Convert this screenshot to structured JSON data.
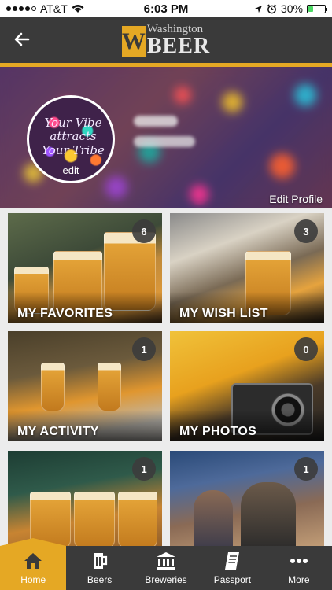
{
  "status": {
    "carrier": "AT&T",
    "time": "6:03 PM",
    "battery": "30%",
    "battery_level": 0.3
  },
  "header": {
    "logo_w": "W",
    "logo_top": "Washington",
    "logo_bottom": "BEER",
    "back_icon": "arrow-left-icon"
  },
  "profile": {
    "avatar_text": "Your Vibe attracts Your Tribe",
    "avatar_edit": "edit",
    "edit_profile": "Edit Profile"
  },
  "tiles": [
    {
      "label": "MY FAVORITES",
      "count": "6"
    },
    {
      "label": "MY WISH LIST",
      "count": "3"
    },
    {
      "label": "MY ACTIVITY",
      "count": "1"
    },
    {
      "label": "MY PHOTOS",
      "count": "0"
    },
    {
      "label": "",
      "count": "1"
    },
    {
      "label": "",
      "count": "1"
    }
  ],
  "tabs": [
    {
      "label": "Home",
      "icon": "home-icon",
      "active": true
    },
    {
      "label": "Beers",
      "icon": "beer-mug-icon"
    },
    {
      "label": "Breweries",
      "icon": "brewery-building-icon"
    },
    {
      "label": "Passport",
      "icon": "passport-book-icon"
    },
    {
      "label": "More",
      "icon": "more-dots-icon"
    }
  ],
  "colors": {
    "accent": "#e5a824",
    "header": "#3a3a3a"
  }
}
